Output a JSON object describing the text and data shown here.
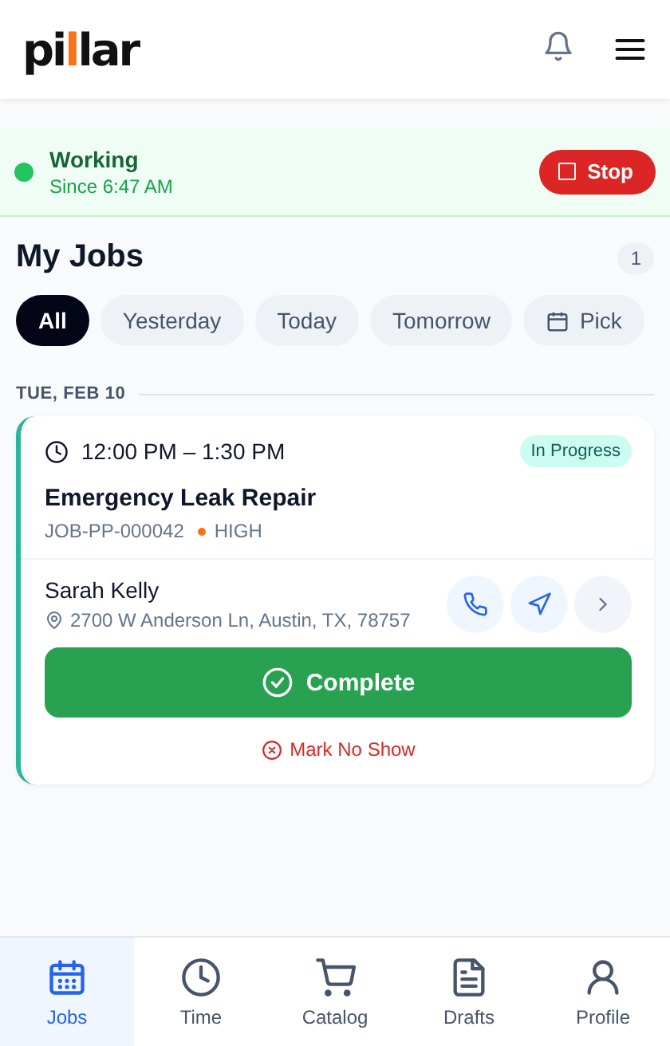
{
  "header": {
    "logo": [
      "pi",
      "l",
      "lar"
    ]
  },
  "status": {
    "label": "Working",
    "since": "Since 6:47 AM",
    "active": true,
    "button": "Stop"
  },
  "jobs": {
    "title": "My Jobs",
    "count": "1",
    "filters": [
      {
        "label": "All",
        "selected": true,
        "kind": "plain"
      },
      {
        "label": "Yesterday",
        "selected": false,
        "kind": "plain"
      },
      {
        "label": "Today",
        "selected": false,
        "kind": "plain"
      },
      {
        "label": "Tomorrow",
        "selected": false,
        "kind": "plain"
      },
      {
        "label": "Pick",
        "selected": false,
        "kind": "date"
      }
    ],
    "groups": [
      {
        "date": "TUE, FEB 10",
        "cards": [
          {
            "time": "12:00 PM – 1:30 PM",
            "status": "In Progress",
            "title": "Emergency Leak Repair",
            "number": "JOB-PP-000042",
            "priority": "HIGH",
            "color": "#f97316",
            "customer": "Sarah Kelly",
            "address": "2700 W Anderson Ln, Austin, TX, 78757",
            "primary": "Complete",
            "secondary": "Mark No Show"
          }
        ]
      }
    ]
  },
  "nav": [
    {
      "label": "Jobs",
      "kind": "calendar",
      "selected": true
    },
    {
      "label": "Time",
      "kind": "clock",
      "selected": false
    },
    {
      "label": "Catalog",
      "kind": "cart",
      "selected": false
    },
    {
      "label": "Drafts",
      "kind": "document",
      "selected": false
    },
    {
      "label": "Profile",
      "kind": "person",
      "selected": false
    }
  ]
}
